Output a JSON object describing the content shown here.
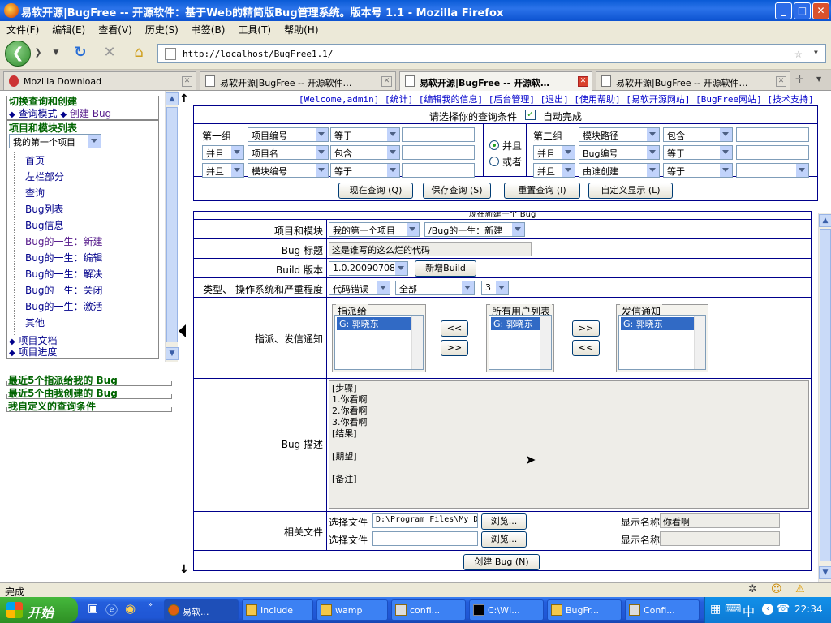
{
  "window": {
    "title": "易软开源|BugFree -- 开源软件：基于Web的精简版Bug管理系统。版本号 1.1 - Mozilla Firefox"
  },
  "menu": [
    "文件(F)",
    "编辑(E)",
    "查看(V)",
    "历史(S)",
    "书签(B)",
    "工具(T)",
    "帮助(H)"
  ],
  "nav": {
    "url": "http://localhost/BugFree1.1/"
  },
  "tabs": [
    {
      "label": "Mozilla Download"
    },
    {
      "label": "易软开源|BugFree -- 开源软件…"
    },
    {
      "label": "易软开源|BugFree -- 开源软…"
    },
    {
      "label": "易软开源|BugFree -- 开源软件…"
    }
  ],
  "left": {
    "switch_title": "切换查询和创建",
    "query_mode": "查询模式",
    "create_bug": "创建 Bug",
    "project_title": "项目和模块列表",
    "project_select": "我的第一个项目",
    "tree": [
      "首页",
      "左栏部分",
      "查询",
      "Bug列表",
      "Bug信息",
      "Bug的一生：新建",
      "Bug的一生：编辑",
      "Bug的一生：解决",
      "Bug的一生：关闭",
      "Bug的一生：激活",
      "其他"
    ],
    "doc": "项目文档",
    "progress": "项目进度",
    "recent_assigned": "最近5个指派给我的 Bug",
    "recent_created": "最近5个由我创建的 Bug",
    "custom_query": "我自定义的查询条件"
  },
  "toplinks": "[Welcome,admin] [统计] [编辑我的信息] [后台管理] [退出] [使用帮助] [易软开源网站] [BugFree网站] [技术支持]",
  "query": {
    "header": "请选择你的查询条件",
    "auto_complete": "自动完成",
    "group1": "第一组",
    "group2": "第二组",
    "and": "并且",
    "or": "或者",
    "g1": [
      {
        "field": "项目编号",
        "op": "等于"
      },
      {
        "logic": "并且",
        "field": "项目名",
        "op": "包含"
      },
      {
        "logic": "并且",
        "field": "模块编号",
        "op": "等于"
      }
    ],
    "g2": [
      {
        "field": "模块路径",
        "op": "包含"
      },
      {
        "logic": "并且",
        "field": "Bug编号",
        "op": "等于"
      },
      {
        "logic": "并且",
        "field": "由谁创建",
        "op": "等于"
      }
    ],
    "buttons": [
      "现在查询 (Q)",
      "保存查询 (S)",
      "重置查询 (I)",
      "自定义显示 (L)"
    ]
  },
  "form": {
    "title": "现在新建一个 Bug",
    "project_label": "项目和模块",
    "project_value": "我的第一个项目",
    "module_value": "/Bug的一生：新建",
    "title_label": "Bug 标题",
    "title_value": "这是谁写的这么烂的代码",
    "build_label": "Build 版本",
    "build_value": "1.0.20090708",
    "new_build": "新增Build",
    "type_label": "类型、 操作系统和严重程度",
    "type_value": "代码错误",
    "os_value": "全部",
    "severity_value": "3",
    "assign_label": "指派、发信通知",
    "assign_to": "指派给",
    "all_users": "所有用户列表",
    "notify": "发信通知",
    "user": "G: 郭晓东",
    "btn_left": "<<",
    "btn_right": ">>",
    "desc_label": "Bug 描述",
    "desc_value": "[步骤]\n1.你看啊\n2.你看啊\n3.你看啊\n[结果]\n\n[期望]\n\n[备注]",
    "files_label": "相关文件",
    "select_file": "选择文件",
    "file1": "D:\\Program Files\\My D",
    "browse": "浏览...",
    "display_name": "显示名称",
    "display1": "你看啊",
    "submit": "创建 Bug (N)"
  },
  "status": "完成",
  "taskbar": {
    "start": "开始",
    "tasks": [
      "易软...",
      "Include",
      "wamp",
      "confi...",
      "C:\\WI...",
      "BugFr...",
      "Confi..."
    ],
    "ime": "中",
    "clock": "22:34"
  }
}
